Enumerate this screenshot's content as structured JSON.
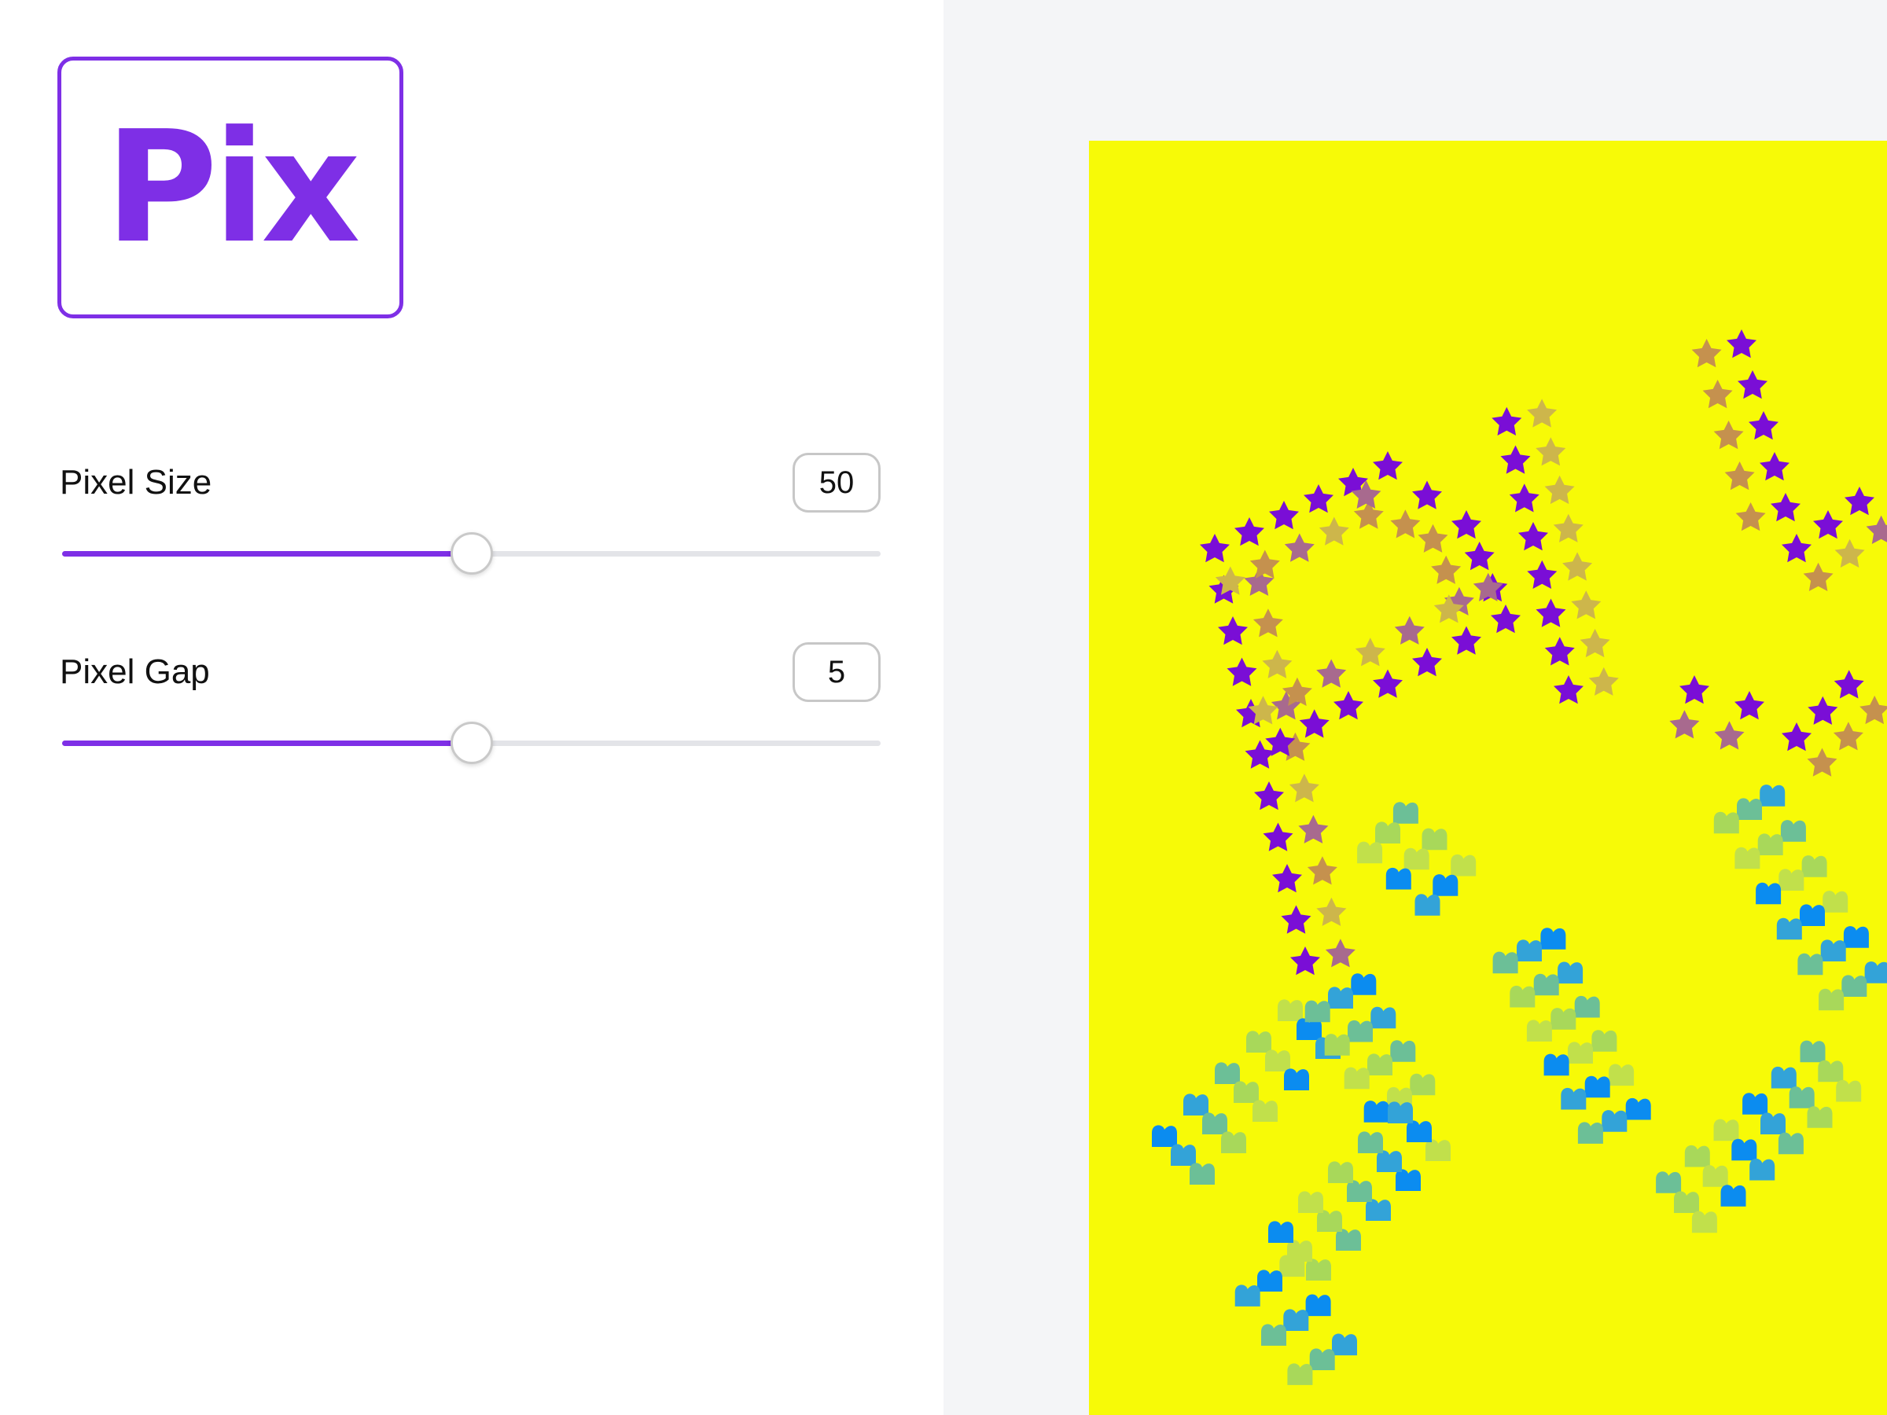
{
  "logo": {
    "text": "Pix",
    "color": "#7e2fe6"
  },
  "controls": [
    {
      "label": "Pixel Size",
      "value": "50",
      "fraction": 0.5
    },
    {
      "label": "Pixel Gap",
      "value": "5",
      "fraction": 0.5
    }
  ],
  "canvas": {
    "background": "#f7fa07",
    "star_colors": [
      "#7a0ed6",
      "#a86a8e",
      "#c5914e",
      "#cdb64b"
    ],
    "heart_colors": [
      "#0b8cf0",
      "#33a3d8",
      "#6cbf97",
      "#a8d85a",
      "#c1e04b"
    ]
  }
}
